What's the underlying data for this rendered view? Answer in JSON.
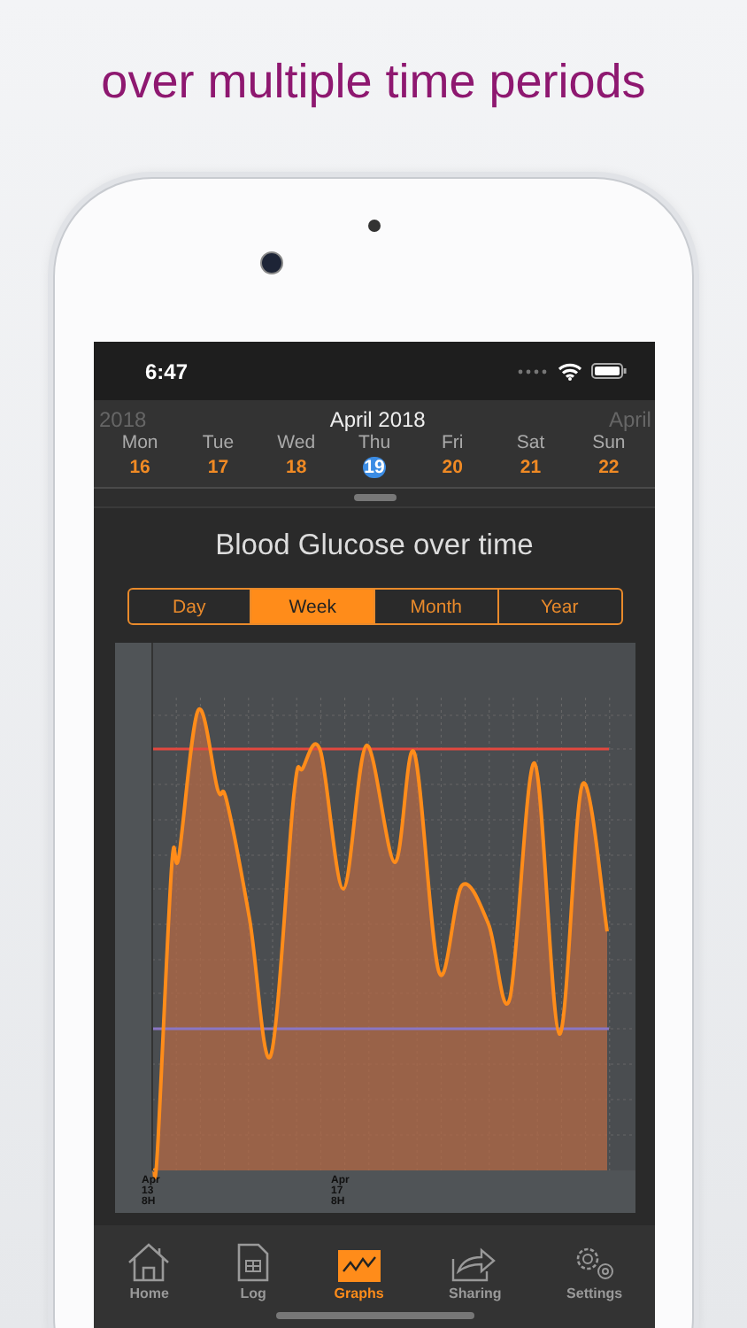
{
  "headline": "over multiple time periods",
  "status_bar": {
    "time": "6:47"
  },
  "calendar": {
    "month": "April 2018",
    "prev_label": "2018",
    "next_label": "April",
    "days": [
      {
        "weekday": "Mon",
        "date": "16",
        "selected": false
      },
      {
        "weekday": "Tue",
        "date": "17",
        "selected": false
      },
      {
        "weekday": "Wed",
        "date": "18",
        "selected": false
      },
      {
        "weekday": "Thu",
        "date": "19",
        "selected": true
      },
      {
        "weekday": "Fri",
        "date": "20",
        "selected": false
      },
      {
        "weekday": "Sat",
        "date": "21",
        "selected": false
      },
      {
        "weekday": "Sun",
        "date": "22",
        "selected": false
      }
    ]
  },
  "graph": {
    "title": "Blood Glucose over time",
    "periods": [
      {
        "label": "Day",
        "selected": false
      },
      {
        "label": "Week",
        "selected": true
      },
      {
        "label": "Month",
        "selected": false
      },
      {
        "label": "Year",
        "selected": false
      }
    ],
    "x_labels": [
      [
        "Apr",
        "13",
        "8H"
      ],
      [
        "Apr",
        "17",
        "8H"
      ]
    ]
  },
  "tab_bar": [
    {
      "label": "Home",
      "kind": "home",
      "selected": false
    },
    {
      "label": "Log",
      "kind": "log",
      "selected": false
    },
    {
      "label": "Graphs",
      "kind": "graphs",
      "selected": true
    },
    {
      "label": "Sharing",
      "kind": "sharing",
      "selected": false
    },
    {
      "label": "Settings",
      "kind": "settings",
      "selected": false
    }
  ]
}
